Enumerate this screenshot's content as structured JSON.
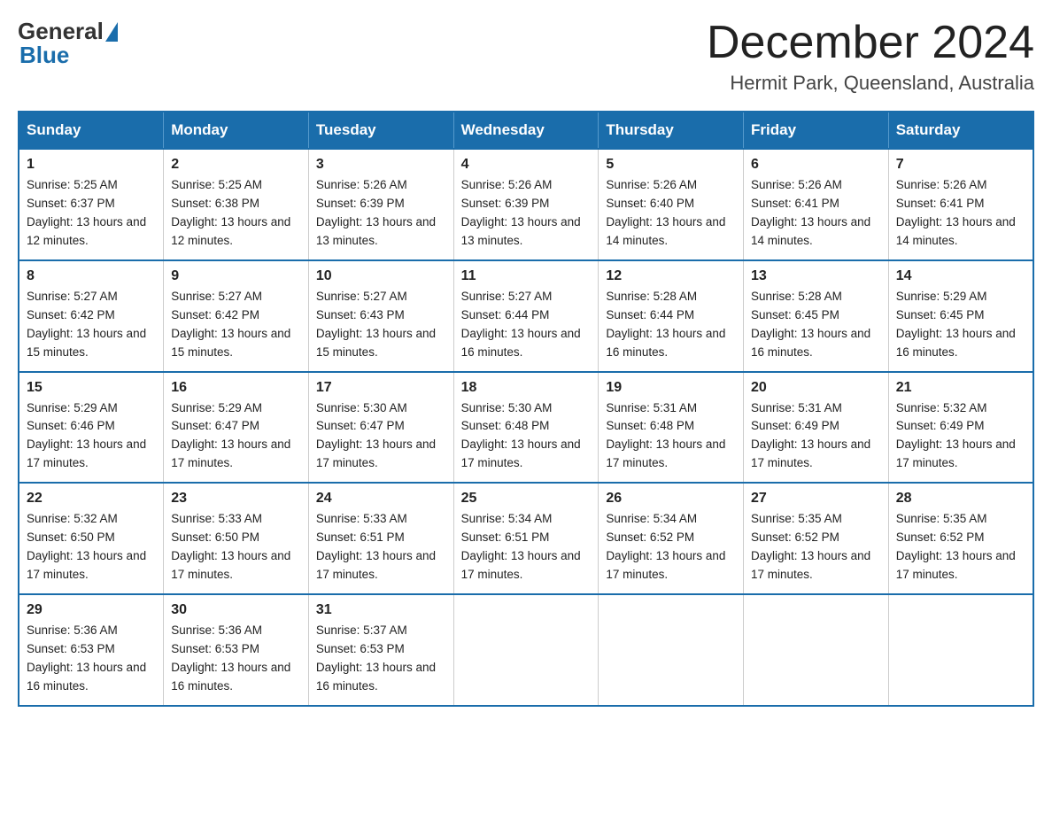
{
  "logo": {
    "general": "General",
    "blue": "Blue"
  },
  "title": "December 2024",
  "subtitle": "Hermit Park, Queensland, Australia",
  "days_header": [
    "Sunday",
    "Monday",
    "Tuesday",
    "Wednesday",
    "Thursday",
    "Friday",
    "Saturday"
  ],
  "weeks": [
    [
      {
        "day": "1",
        "sunrise": "5:25 AM",
        "sunset": "6:37 PM",
        "daylight": "13 hours and 12 minutes."
      },
      {
        "day": "2",
        "sunrise": "5:25 AM",
        "sunset": "6:38 PM",
        "daylight": "13 hours and 12 minutes."
      },
      {
        "day": "3",
        "sunrise": "5:26 AM",
        "sunset": "6:39 PM",
        "daylight": "13 hours and 13 minutes."
      },
      {
        "day": "4",
        "sunrise": "5:26 AM",
        "sunset": "6:39 PM",
        "daylight": "13 hours and 13 minutes."
      },
      {
        "day": "5",
        "sunrise": "5:26 AM",
        "sunset": "6:40 PM",
        "daylight": "13 hours and 14 minutes."
      },
      {
        "day": "6",
        "sunrise": "5:26 AM",
        "sunset": "6:41 PM",
        "daylight": "13 hours and 14 minutes."
      },
      {
        "day": "7",
        "sunrise": "5:26 AM",
        "sunset": "6:41 PM",
        "daylight": "13 hours and 14 minutes."
      }
    ],
    [
      {
        "day": "8",
        "sunrise": "5:27 AM",
        "sunset": "6:42 PM",
        "daylight": "13 hours and 15 minutes."
      },
      {
        "day": "9",
        "sunrise": "5:27 AM",
        "sunset": "6:42 PM",
        "daylight": "13 hours and 15 minutes."
      },
      {
        "day": "10",
        "sunrise": "5:27 AM",
        "sunset": "6:43 PM",
        "daylight": "13 hours and 15 minutes."
      },
      {
        "day": "11",
        "sunrise": "5:27 AM",
        "sunset": "6:44 PM",
        "daylight": "13 hours and 16 minutes."
      },
      {
        "day": "12",
        "sunrise": "5:28 AM",
        "sunset": "6:44 PM",
        "daylight": "13 hours and 16 minutes."
      },
      {
        "day": "13",
        "sunrise": "5:28 AM",
        "sunset": "6:45 PM",
        "daylight": "13 hours and 16 minutes."
      },
      {
        "day": "14",
        "sunrise": "5:29 AM",
        "sunset": "6:45 PM",
        "daylight": "13 hours and 16 minutes."
      }
    ],
    [
      {
        "day": "15",
        "sunrise": "5:29 AM",
        "sunset": "6:46 PM",
        "daylight": "13 hours and 17 minutes."
      },
      {
        "day": "16",
        "sunrise": "5:29 AM",
        "sunset": "6:47 PM",
        "daylight": "13 hours and 17 minutes."
      },
      {
        "day": "17",
        "sunrise": "5:30 AM",
        "sunset": "6:47 PM",
        "daylight": "13 hours and 17 minutes."
      },
      {
        "day": "18",
        "sunrise": "5:30 AM",
        "sunset": "6:48 PM",
        "daylight": "13 hours and 17 minutes."
      },
      {
        "day": "19",
        "sunrise": "5:31 AM",
        "sunset": "6:48 PM",
        "daylight": "13 hours and 17 minutes."
      },
      {
        "day": "20",
        "sunrise": "5:31 AM",
        "sunset": "6:49 PM",
        "daylight": "13 hours and 17 minutes."
      },
      {
        "day": "21",
        "sunrise": "5:32 AM",
        "sunset": "6:49 PM",
        "daylight": "13 hours and 17 minutes."
      }
    ],
    [
      {
        "day": "22",
        "sunrise": "5:32 AM",
        "sunset": "6:50 PM",
        "daylight": "13 hours and 17 minutes."
      },
      {
        "day": "23",
        "sunrise": "5:33 AM",
        "sunset": "6:50 PM",
        "daylight": "13 hours and 17 minutes."
      },
      {
        "day": "24",
        "sunrise": "5:33 AM",
        "sunset": "6:51 PM",
        "daylight": "13 hours and 17 minutes."
      },
      {
        "day": "25",
        "sunrise": "5:34 AM",
        "sunset": "6:51 PM",
        "daylight": "13 hours and 17 minutes."
      },
      {
        "day": "26",
        "sunrise": "5:34 AM",
        "sunset": "6:52 PM",
        "daylight": "13 hours and 17 minutes."
      },
      {
        "day": "27",
        "sunrise": "5:35 AM",
        "sunset": "6:52 PM",
        "daylight": "13 hours and 17 minutes."
      },
      {
        "day": "28",
        "sunrise": "5:35 AM",
        "sunset": "6:52 PM",
        "daylight": "13 hours and 17 minutes."
      }
    ],
    [
      {
        "day": "29",
        "sunrise": "5:36 AM",
        "sunset": "6:53 PM",
        "daylight": "13 hours and 16 minutes."
      },
      {
        "day": "30",
        "sunrise": "5:36 AM",
        "sunset": "6:53 PM",
        "daylight": "13 hours and 16 minutes."
      },
      {
        "day": "31",
        "sunrise": "5:37 AM",
        "sunset": "6:53 PM",
        "daylight": "13 hours and 16 minutes."
      },
      null,
      null,
      null,
      null
    ]
  ]
}
